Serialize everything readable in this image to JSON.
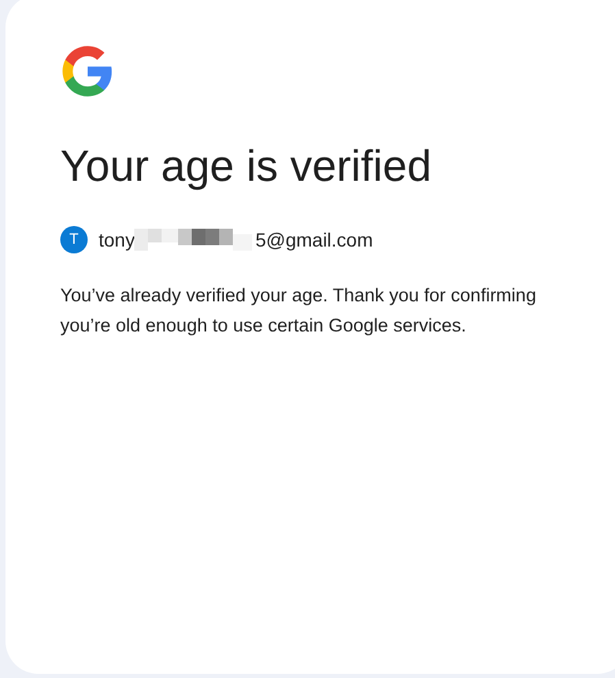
{
  "heading": "Your age is verified",
  "account": {
    "avatar_letter": "T",
    "email_start": "tony",
    "email_end": "5@gmail.com"
  },
  "message": "You’ve already verified your age. Thank you for confirming you’re old enough to use certain Google services."
}
